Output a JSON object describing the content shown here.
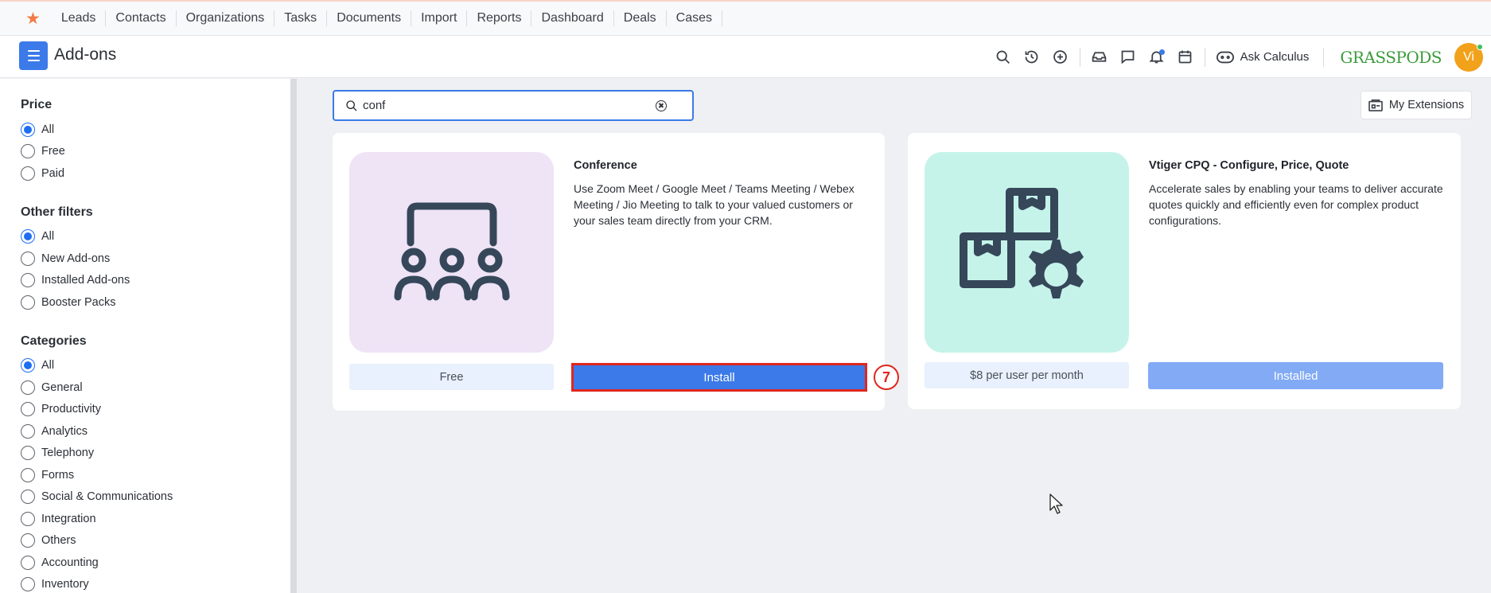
{
  "topnav": {
    "items": [
      "Leads",
      "Contacts",
      "Organizations",
      "Tasks",
      "Documents",
      "Import",
      "Reports",
      "Dashboard",
      "Deals",
      "Cases"
    ]
  },
  "header": {
    "title": "Add-ons",
    "ask_label": "Ask Calculus",
    "logo_text": "GRASSPODS",
    "avatar_initials": "Vi"
  },
  "sidebar": {
    "price": {
      "title": "Price",
      "options": [
        "All",
        "Free",
        "Paid"
      ],
      "selected": "All"
    },
    "other": {
      "title": "Other filters",
      "options": [
        "All",
        "New Add-ons",
        "Installed Add-ons",
        "Booster Packs"
      ],
      "selected": "All"
    },
    "categories": {
      "title": "Categories",
      "options": [
        "All",
        "General",
        "Productivity",
        "Analytics",
        "Telephony",
        "Forms",
        "Social & Communications",
        "Integration",
        "Others",
        "Accounting",
        "Inventory"
      ],
      "selected": "All"
    }
  },
  "search": {
    "value": "conf"
  },
  "my_extensions_label": "My Extensions",
  "cards": [
    {
      "title": "Conference",
      "description": "Use Zoom Meet / Google Meet / Teams Meeting / Webex Meeting / Jio Meeting to talk to your valued customers or your sales team directly from your CRM.",
      "price": "Free",
      "action": "Install"
    },
    {
      "title": "Vtiger CPQ - Configure, Price, Quote",
      "description": "Accelerate sales by enabling your teams to deliver accurate quotes quickly and efficiently even for complex product configurations.",
      "price": "$8 per user per month",
      "action": "Installed"
    }
  ],
  "annotation_badge": "7",
  "colors": {
    "accent": "#3b7ae8",
    "highlight": "#e0261f",
    "star": "#f27a43"
  }
}
